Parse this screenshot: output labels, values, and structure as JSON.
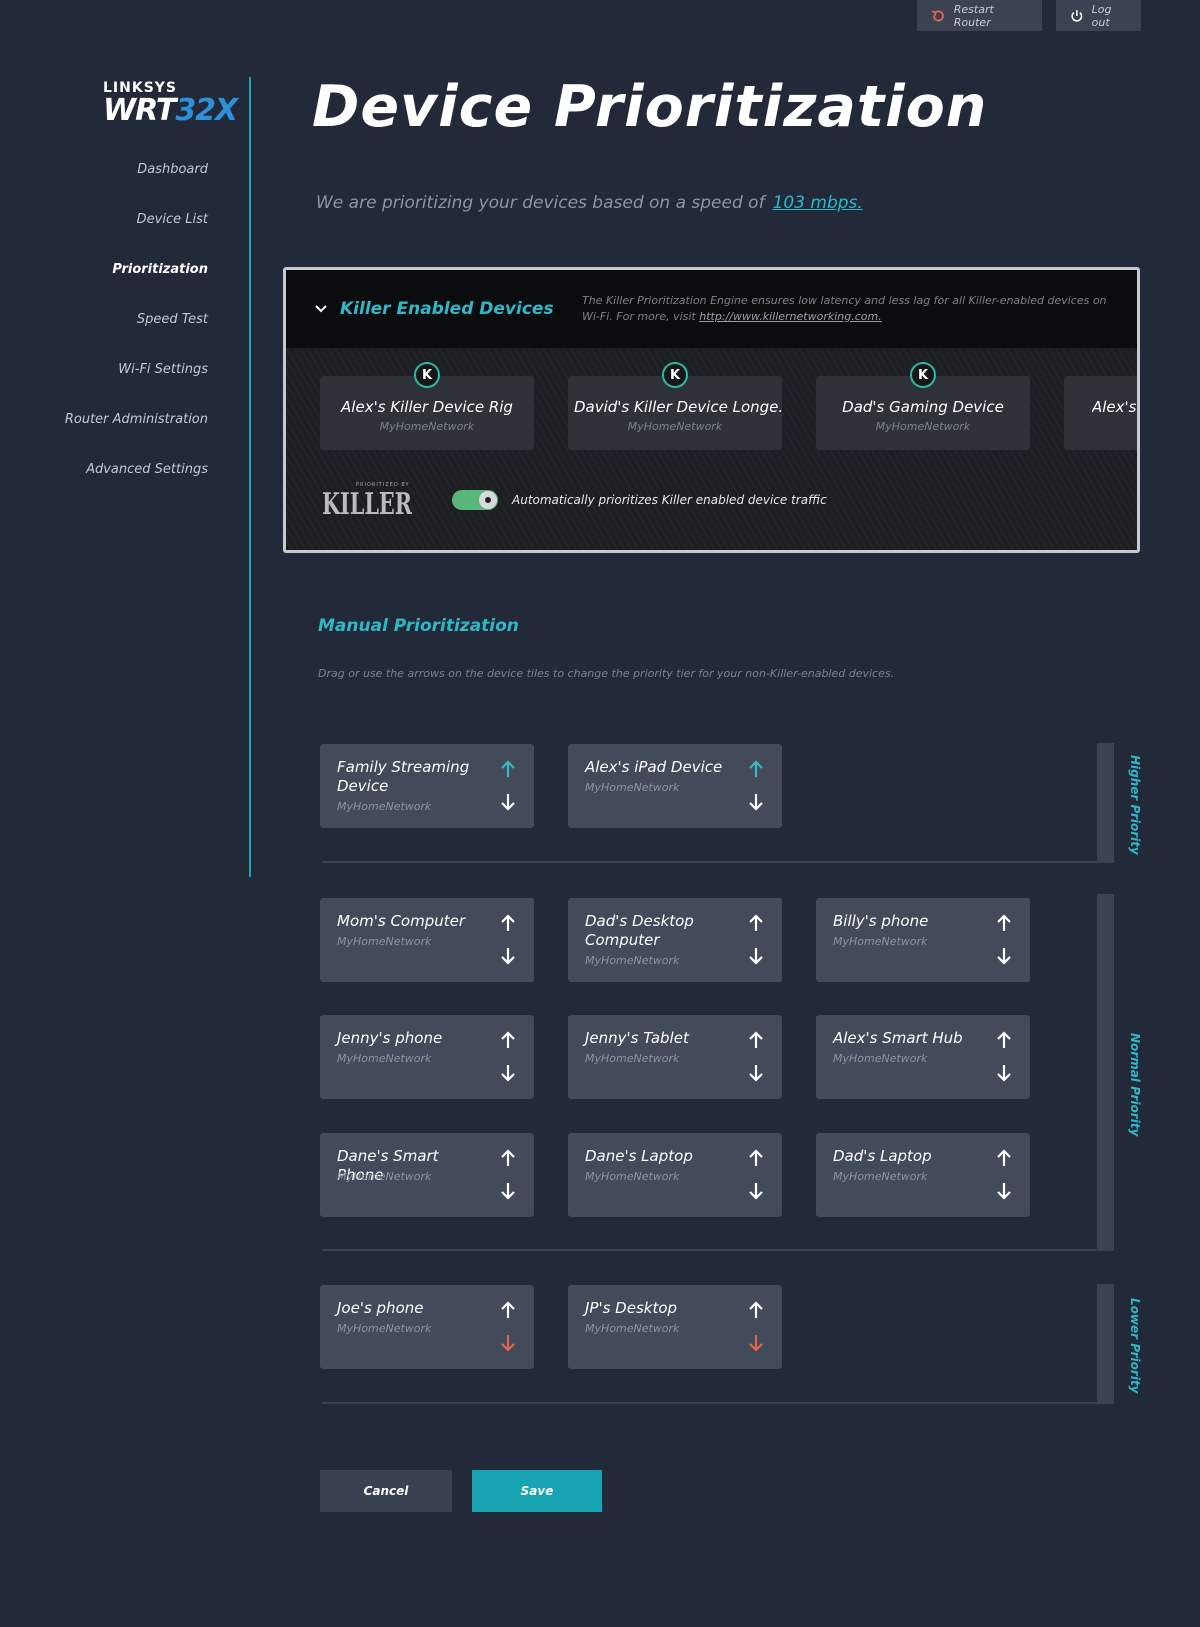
{
  "topbar": {
    "restart_label": "Restart Router",
    "logout_label": "Log out"
  },
  "logo": {
    "brand": "LINKSYS",
    "model_prefix": "WRT",
    "model_suffix": "32X"
  },
  "sidebar": {
    "items": [
      {
        "label": "Dashboard"
      },
      {
        "label": "Device List"
      },
      {
        "label": "Prioritization",
        "active": true
      },
      {
        "label": "Speed Test"
      },
      {
        "label": "Wi-Fi Settings"
      },
      {
        "label": "Router Administration"
      },
      {
        "label": "Advanced Settings"
      }
    ]
  },
  "page": {
    "title": "Device Prioritization",
    "speed_text": "We are prioritizing your devices based on a speed of",
    "speed_value": "103 mbps."
  },
  "killer": {
    "title": "Killer Enabled Devices",
    "desc": "The Killer Prioritization Engine ensures low latency and less lag for all Killer-enabled devices on Wi-Fi. For more, visit",
    "link": "http://www.killernetworking.com.",
    "devices": [
      {
        "name": "Alex's Killer Device Rig",
        "network": "MyHomeNetwork"
      },
      {
        "name": "David's Killer Device Longe...",
        "network": "MyHomeNetwork"
      },
      {
        "name": "Dad's Gaming Device",
        "network": "MyHomeNetwork"
      },
      {
        "name": "Alex's",
        "network": "My"
      }
    ],
    "logo_small": "PRIORITIZED BY",
    "logo_big": "KILLER",
    "toggle_on": true,
    "toggle_label": "Automatically prioritizes Killer enabled device traffic"
  },
  "manual": {
    "title": "Manual Prioritization",
    "desc": "Drag or use the arrows on the device tiles to change the priority tier for your non-Killer-enabled devices.",
    "tiers": {
      "higher": {
        "label": "Higher Priority",
        "devices": [
          {
            "name": "Family Streaming Device",
            "network": "MyHomeNetwork"
          },
          {
            "name": "Alex's iPad Device",
            "network": "MyHomeNetwork"
          }
        ]
      },
      "normal": {
        "label": "Normal Priority",
        "devices": [
          {
            "name": "Mom's Computer",
            "network": "MyHomeNetwork"
          },
          {
            "name": "Dad's Desktop Computer",
            "network": "MyHomeNetwork"
          },
          {
            "name": "Billy's phone",
            "network": "MyHomeNetwork"
          },
          {
            "name": "Jenny's phone",
            "network": "MyHomeNetwork"
          },
          {
            "name": "Jenny's Tablet",
            "network": "MyHomeNetwork"
          },
          {
            "name": "Alex's Smart Hub",
            "network": "MyHomeNetwork"
          },
          {
            "name": "Dane's Smart Phone",
            "network": "MyHomeNetwork"
          },
          {
            "name": "Dane's Laptop",
            "network": "MyHomeNetwork"
          },
          {
            "name": "Dad's Laptop",
            "network": "MyHomeNetwork"
          }
        ]
      },
      "lower": {
        "label": "Lower Priority",
        "devices": [
          {
            "name": "Joe's phone",
            "network": "MyHomeNetwork"
          },
          {
            "name": "JP's Desktop",
            "network": "MyHomeNetwork"
          }
        ]
      }
    }
  },
  "actions": {
    "cancel_label": "Cancel",
    "save_label": "Save"
  },
  "colors": {
    "accent": "#2eb8c8",
    "up_active": "#3bb8c8",
    "down_disabled": "#e0664e",
    "toggle": "#59b77a",
    "save": "#18a3b2"
  }
}
